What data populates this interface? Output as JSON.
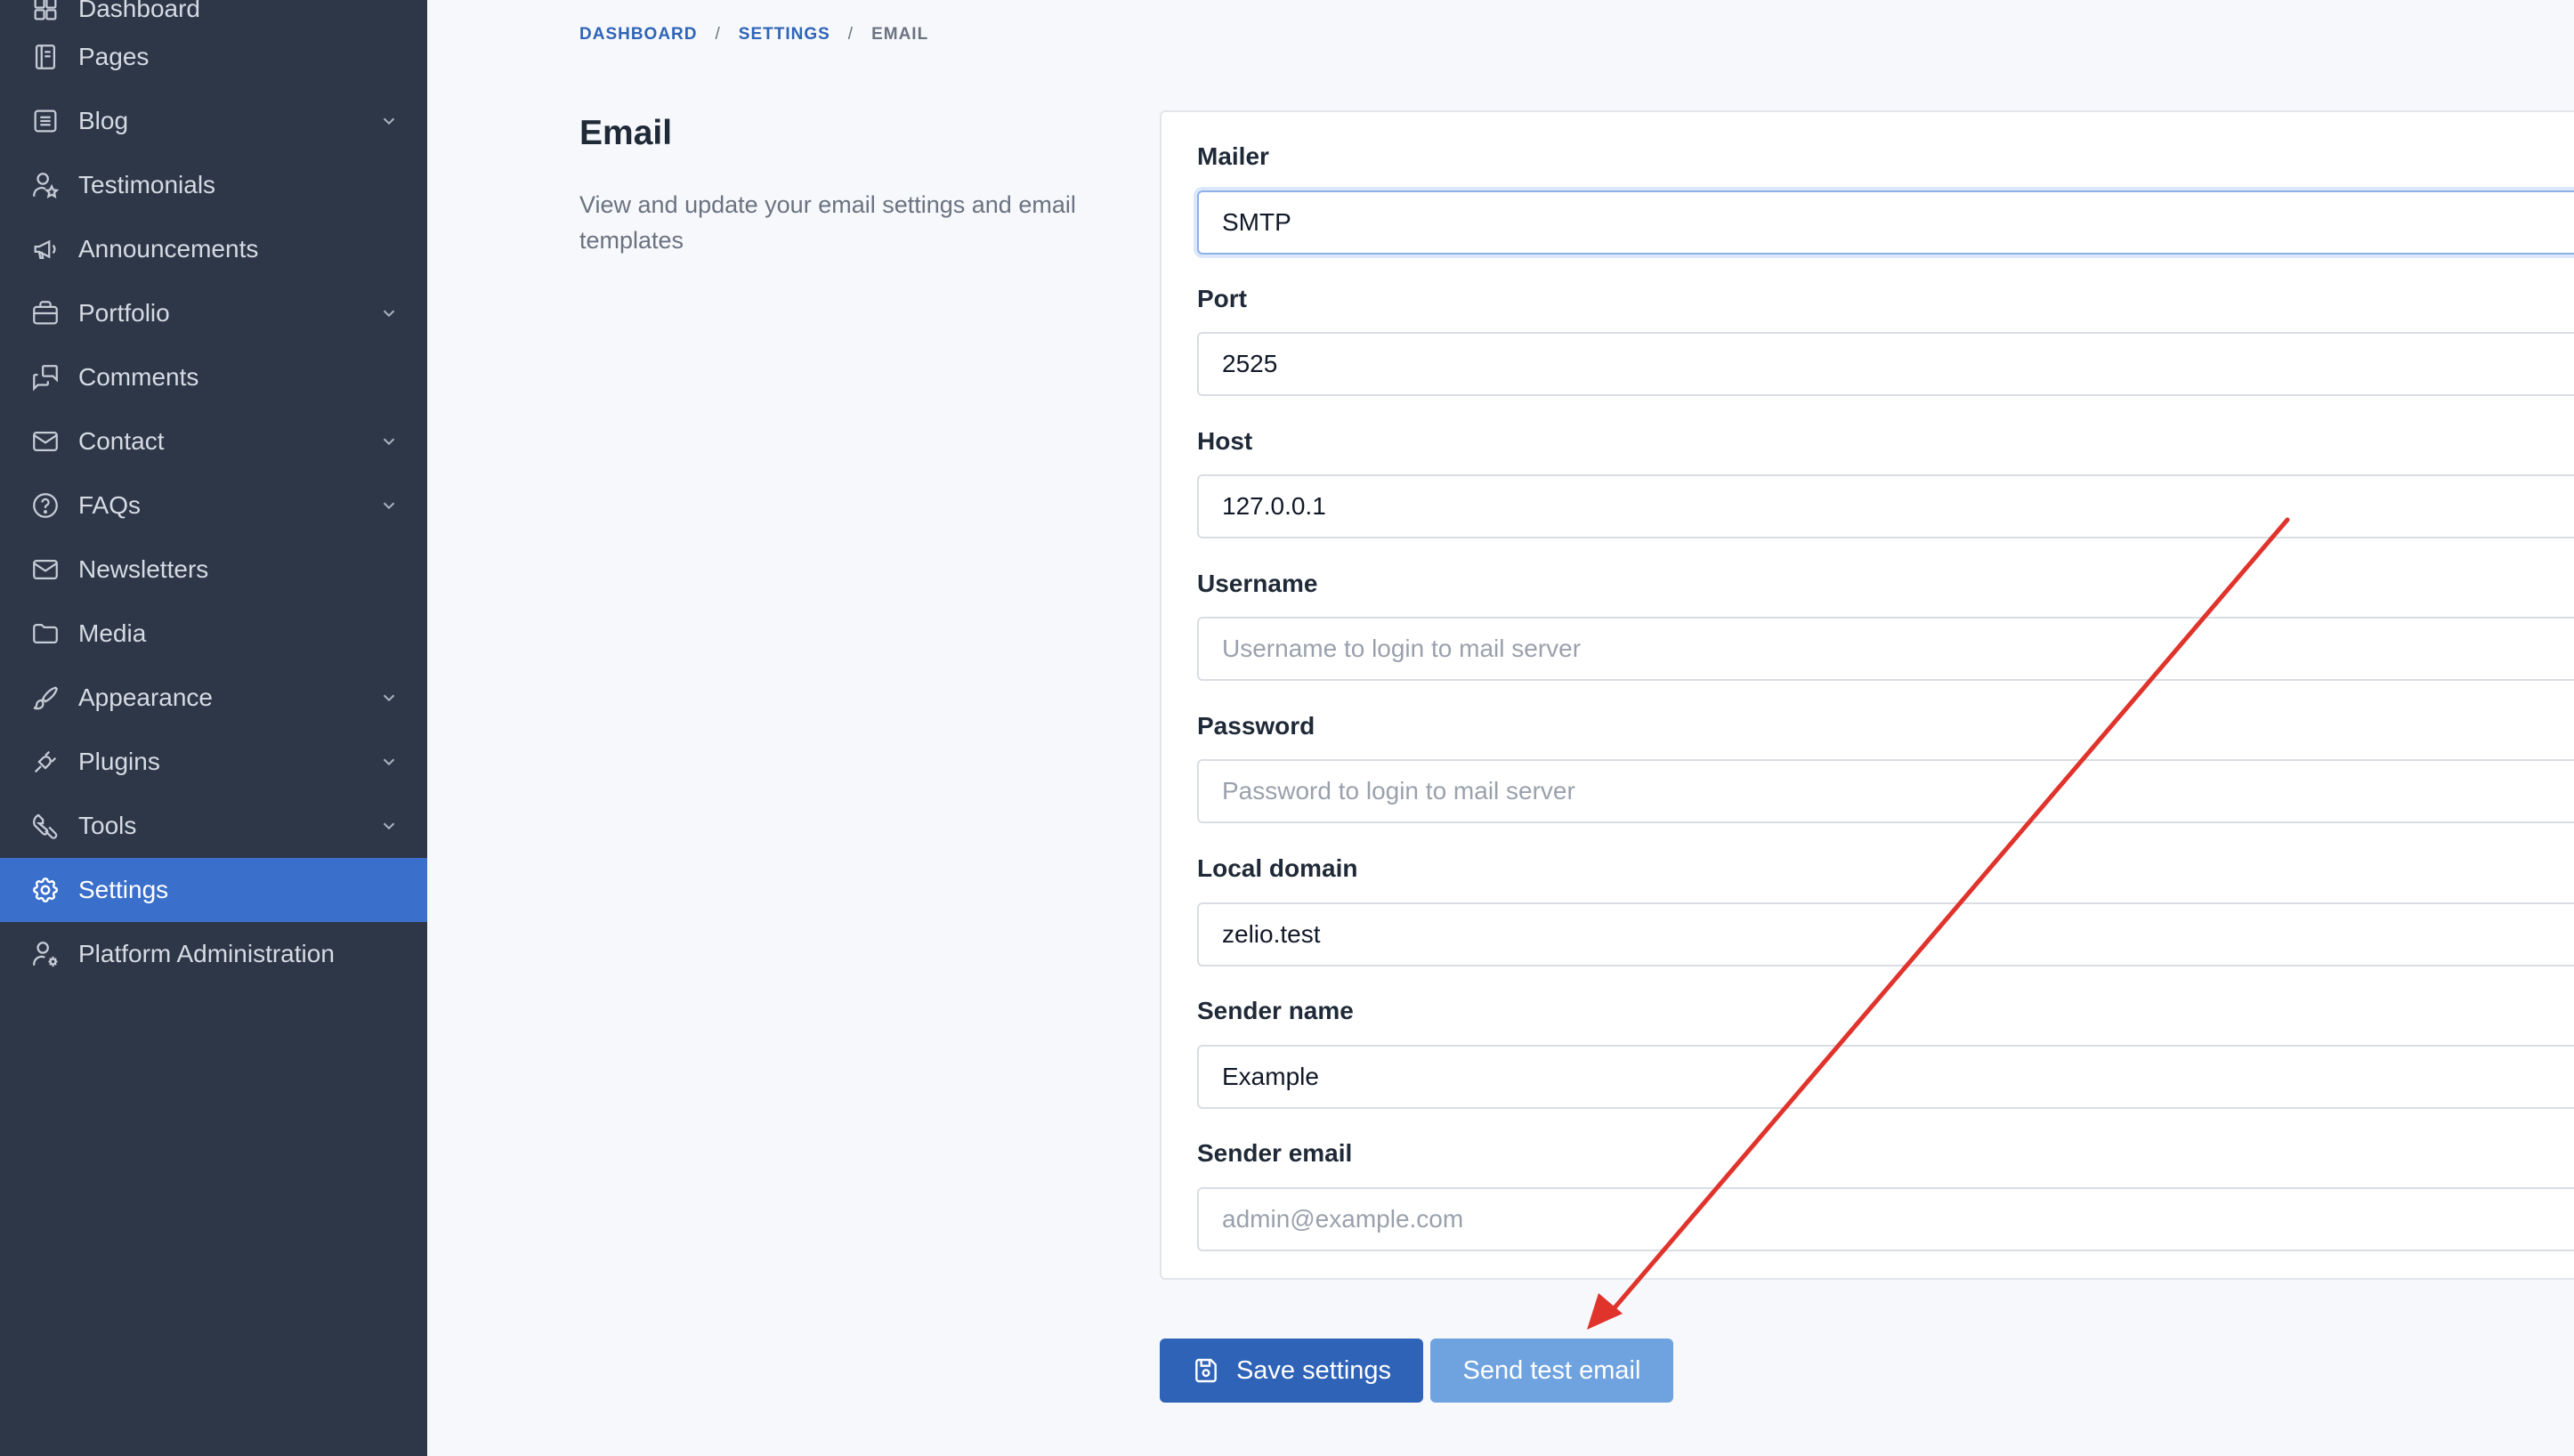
{
  "sidebar": {
    "items": [
      {
        "label": "Dashboard",
        "icon": "dashboard-icon",
        "has_submenu": false
      },
      {
        "label": "Pages",
        "icon": "book-icon",
        "has_submenu": false
      },
      {
        "label": "Blog",
        "icon": "list-icon",
        "has_submenu": true
      },
      {
        "label": "Testimonials",
        "icon": "user-star-icon",
        "has_submenu": false
      },
      {
        "label": "Announcements",
        "icon": "megaphone-icon",
        "has_submenu": false
      },
      {
        "label": "Portfolio",
        "icon": "briefcase-icon",
        "has_submenu": true
      },
      {
        "label": "Comments",
        "icon": "comments-icon",
        "has_submenu": false
      },
      {
        "label": "Contact",
        "icon": "mail-icon",
        "has_submenu": true
      },
      {
        "label": "FAQs",
        "icon": "help-circle-icon",
        "has_submenu": true
      },
      {
        "label": "Newsletters",
        "icon": "mail-icon",
        "has_submenu": false
      },
      {
        "label": "Media",
        "icon": "folder-icon",
        "has_submenu": false
      },
      {
        "label": "Appearance",
        "icon": "brush-icon",
        "has_submenu": true
      },
      {
        "label": "Plugins",
        "icon": "plug-icon",
        "has_submenu": true
      },
      {
        "label": "Tools",
        "icon": "tools-icon",
        "has_submenu": true
      },
      {
        "label": "Settings",
        "icon": "gear-icon",
        "has_submenu": false,
        "active": true
      },
      {
        "label": "Platform Administration",
        "icon": "user-cog-icon",
        "has_submenu": false
      }
    ]
  },
  "breadcrumb": {
    "items": [
      "DASHBOARD",
      "SETTINGS"
    ],
    "separator": "/",
    "current": "EMAIL"
  },
  "section": {
    "title": "Email",
    "description": "View and update your email settings and email templates"
  },
  "form": {
    "mailer": {
      "label": "Mailer",
      "value": "SMTP"
    },
    "port": {
      "label": "Port",
      "value": "2525",
      "placeholder": ""
    },
    "host": {
      "label": "Host",
      "value": "127.0.0.1",
      "placeholder": ""
    },
    "username": {
      "label": "Username",
      "value": "",
      "placeholder": "Username to login to mail server"
    },
    "password": {
      "label": "Password",
      "value": "",
      "placeholder": "Password to login to mail server"
    },
    "local_domain": {
      "label": "Local domain",
      "value": "zelio.test",
      "placeholder": ""
    },
    "sender_name": {
      "label": "Sender name",
      "value": "Example",
      "placeholder": ""
    },
    "sender_email": {
      "label": "Sender email",
      "value": "",
      "placeholder": "admin@example.com"
    }
  },
  "actions": {
    "save_label": "Save settings",
    "test_label": "Send test email"
  },
  "colors": {
    "sidebar_bg": "#2d3748",
    "active_item": "#3a6fcb",
    "primary_button": "#2f63b8",
    "secondary_button": "#6fa3e0",
    "annotation_arrow": "#e0332c"
  }
}
